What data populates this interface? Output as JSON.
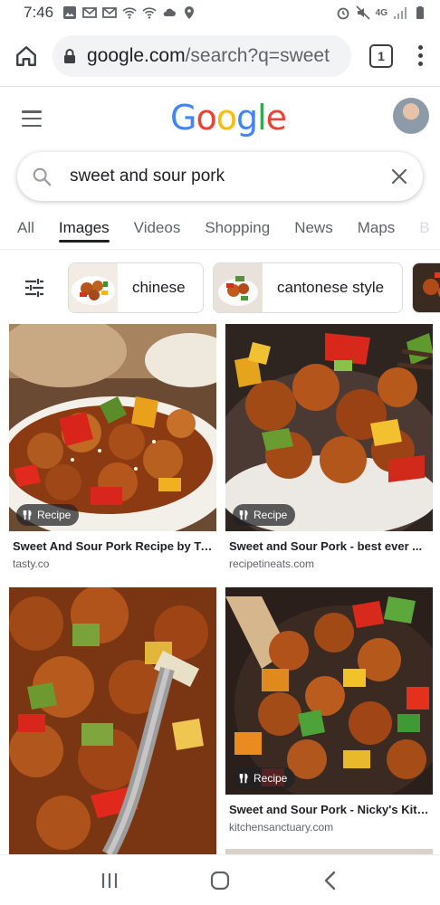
{
  "status_bar": {
    "time": "7:46",
    "network": "4G"
  },
  "browser": {
    "url_host": "google.com",
    "url_path": "/search?q=sweet",
    "tab_count": "1"
  },
  "google": {
    "logo_letters": [
      {
        "char": "G",
        "color": "#4285F4"
      },
      {
        "char": "o",
        "color": "#EA4335"
      },
      {
        "char": "o",
        "color": "#FBBC05"
      },
      {
        "char": "g",
        "color": "#4285F4"
      },
      {
        "char": "l",
        "color": "#34A853"
      },
      {
        "char": "e",
        "color": "#EA4335"
      }
    ]
  },
  "search": {
    "query": "sweet and sour pork"
  },
  "tabs": [
    {
      "label": "All",
      "active": false
    },
    {
      "label": "Images",
      "active": true
    },
    {
      "label": "Videos",
      "active": false
    },
    {
      "label": "Shopping",
      "active": false
    },
    {
      "label": "News",
      "active": false
    },
    {
      "label": "Maps",
      "active": false
    },
    {
      "label": "B",
      "active": false
    }
  ],
  "chips": [
    {
      "label": "chinese"
    },
    {
      "label": "cantonese style"
    }
  ],
  "results": [
    {
      "badge": "Recipe",
      "title": "Sweet And Sour Pork Recipe by Ta...",
      "source": "tasty.co"
    },
    {
      "badge": "Recipe",
      "title": "Sweet and Sour Pork - best ever ...",
      "source": "recipetineats.com"
    },
    {
      "badge": "",
      "title": "",
      "source": ""
    },
    {
      "badge": "Recipe",
      "title": "Sweet and Sour Pork - Nicky's Kitc...",
      "source": "kitchensanctuary.com"
    }
  ],
  "colors": {
    "accent": "#1a73e8",
    "text": "#202124",
    "muted": "#5f6368"
  }
}
